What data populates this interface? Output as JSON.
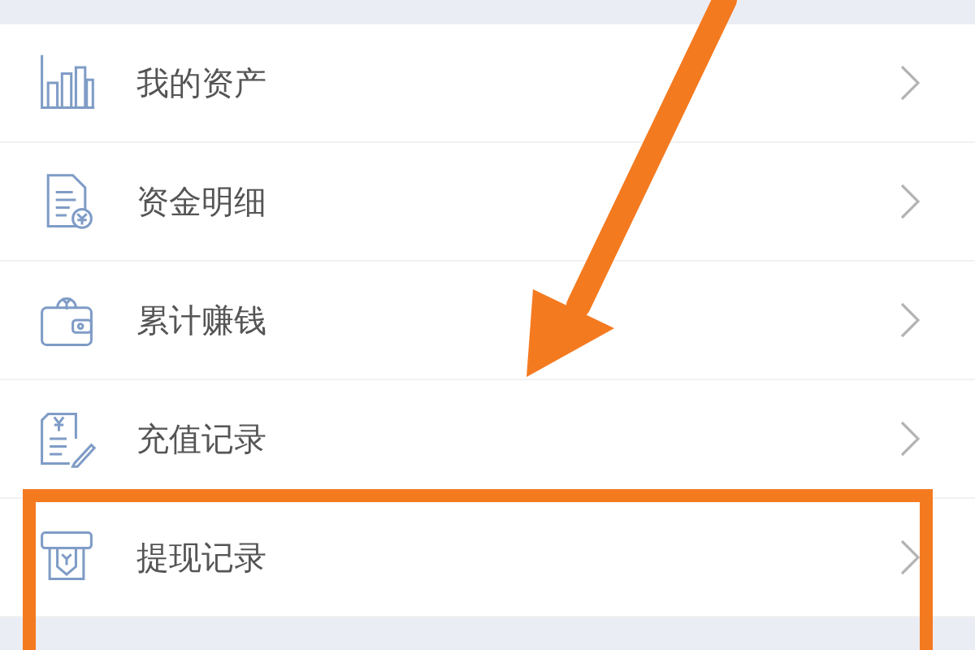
{
  "menu": {
    "items": [
      {
        "label": "我的资产",
        "highlighted": false
      },
      {
        "label": "资金明细",
        "highlighted": false
      },
      {
        "label": "累计赚钱",
        "highlighted": false
      },
      {
        "label": "充值记录",
        "highlighted": false
      },
      {
        "label": "提现记录",
        "highlighted": true
      }
    ]
  }
}
